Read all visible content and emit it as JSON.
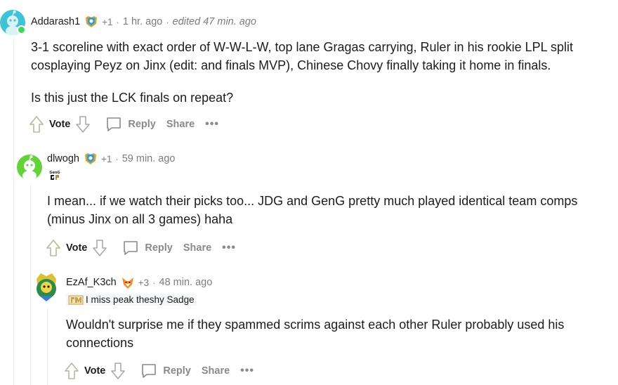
{
  "comments": [
    {
      "username": "Addarash1",
      "karma": "+1",
      "time": "1 hr. ago",
      "edited": "edited 47 min. ago",
      "body": [
        "3-1 scoreline with exact order of W-W-L-W, top lane Gragas carrying, Ruler in his rookie LPL split cosplaying Peyz on Jinx (edit: and finals MVP), Chinese Chovy finally taking it home in finals.",
        "Is this just the LCK finals on repeat?"
      ],
      "vote_label": "Vote",
      "reply_label": "Reply",
      "share_label": "Share"
    },
    {
      "username": "dlwogh",
      "karma": "+1",
      "time": "59 min. ago",
      "flair_text": "GenG",
      "body": [
        "I mean... if we watch their picks too... JDG and GenG pretty much played identical team comps (minus Jinx on all 3 games) haha"
      ],
      "vote_label": "Vote",
      "reply_label": "Reply",
      "share_label": "Share"
    },
    {
      "username": "EzAf_K3ch",
      "karma": "+3",
      "time": "48 min. ago",
      "flair_text": "I miss peak theshy Sadge",
      "body": [
        "Wouldn't surprise me if they spammed scrims against each other Ruler probably used his connections"
      ],
      "vote_label": "Vote",
      "reply_label": "Reply",
      "share_label": "Share"
    }
  ],
  "separator": "·",
  "icons": {
    "upvote": "arrow-up-icon",
    "downvote": "arrow-down-icon",
    "reply": "chat-bubble-icon",
    "more": "more-dots-icon"
  },
  "colors": {
    "meta_gray": "#7c7c7c",
    "action_gray": "#878a8c",
    "online_green": "#46d160",
    "avatar1": "#3fc4d6",
    "avatar2": "#64d33a"
  }
}
